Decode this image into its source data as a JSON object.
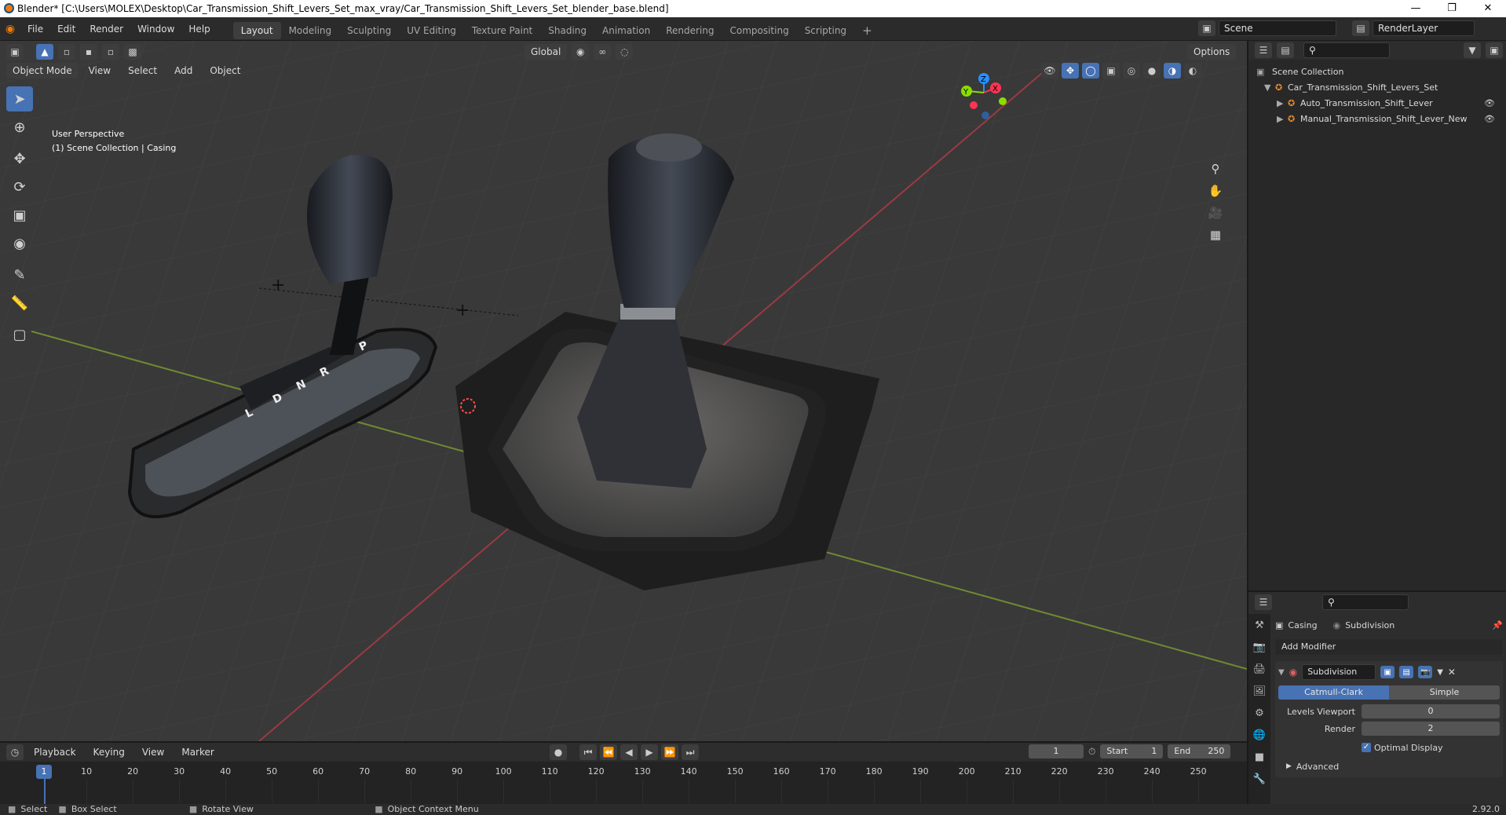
{
  "window": {
    "title": "Blender* [C:\\Users\\MOLEX\\Desktop\\Car_Transmission_Shift_Levers_Set_max_vray/Car_Transmission_Shift_Levers_Set_blender_base.blend]"
  },
  "menu": [
    "File",
    "Edit",
    "Render",
    "Window",
    "Help"
  ],
  "workspaces": [
    "Layout",
    "Modeling",
    "Sculpting",
    "UV Editing",
    "Texture Paint",
    "Shading",
    "Animation",
    "Rendering",
    "Compositing",
    "Scripting"
  ],
  "active_workspace": "Layout",
  "scene": {
    "label": "Scene",
    "layer": "RenderLayer"
  },
  "viewport": {
    "mode": "Object Mode",
    "menus": [
      "View",
      "Select",
      "Add",
      "Object"
    ],
    "orientation": "Global",
    "options": "Options",
    "perspective": "User Perspective",
    "collection_info": "(1) Scene Collection | Casing",
    "gizmo_axes": [
      "Z",
      "Y",
      "X"
    ],
    "gear_letters": [
      "P",
      "R",
      "N",
      "D",
      "L"
    ]
  },
  "outliner": {
    "root": "Scene Collection",
    "items": [
      {
        "label": "Car_Transmission_Shift_Levers_Set",
        "level": 1
      },
      {
        "label": "Auto_Transmission_Shift_Lever",
        "level": 2
      },
      {
        "label": "Manual_Transmission_Shift_Lever_New",
        "level": 2
      }
    ]
  },
  "properties": {
    "object": "Casing",
    "modifier_breadcrumb": "Subdivision",
    "add_modifier": "Add Modifier",
    "modifier_name": "Subdivision",
    "types": [
      "Catmull-Clark",
      "Simple"
    ],
    "active_type": "Catmull-Clark",
    "levels_viewport_label": "Levels Viewport",
    "levels_viewport_value": "0",
    "render_label": "Render",
    "render_value": "2",
    "optimal_display": "Optimal Display",
    "advanced": "Advanced"
  },
  "timeline": {
    "menus": [
      "Playback",
      "Keying",
      "View",
      "Marker"
    ],
    "current_frame": "1",
    "start_label": "Start",
    "start": "1",
    "end_label": "End",
    "end": "250",
    "ticks": [
      "10",
      "20",
      "30",
      "40",
      "50",
      "60",
      "70",
      "80",
      "90",
      "100",
      "110",
      "120",
      "130",
      "140",
      "150",
      "160",
      "170",
      "180",
      "190",
      "200",
      "210",
      "220",
      "230",
      "240",
      "250"
    ],
    "playhead": "1"
  },
  "status": {
    "select": "Select",
    "box_select": "Box Select",
    "rotate_view": "Rotate View",
    "context_menu": "Object Context Menu",
    "version": "2.92.0"
  },
  "colors": {
    "accent": "#4772b3",
    "x_axis": "#ff3352",
    "y_axis": "#8bdc00",
    "z_axis": "#2890ff"
  }
}
